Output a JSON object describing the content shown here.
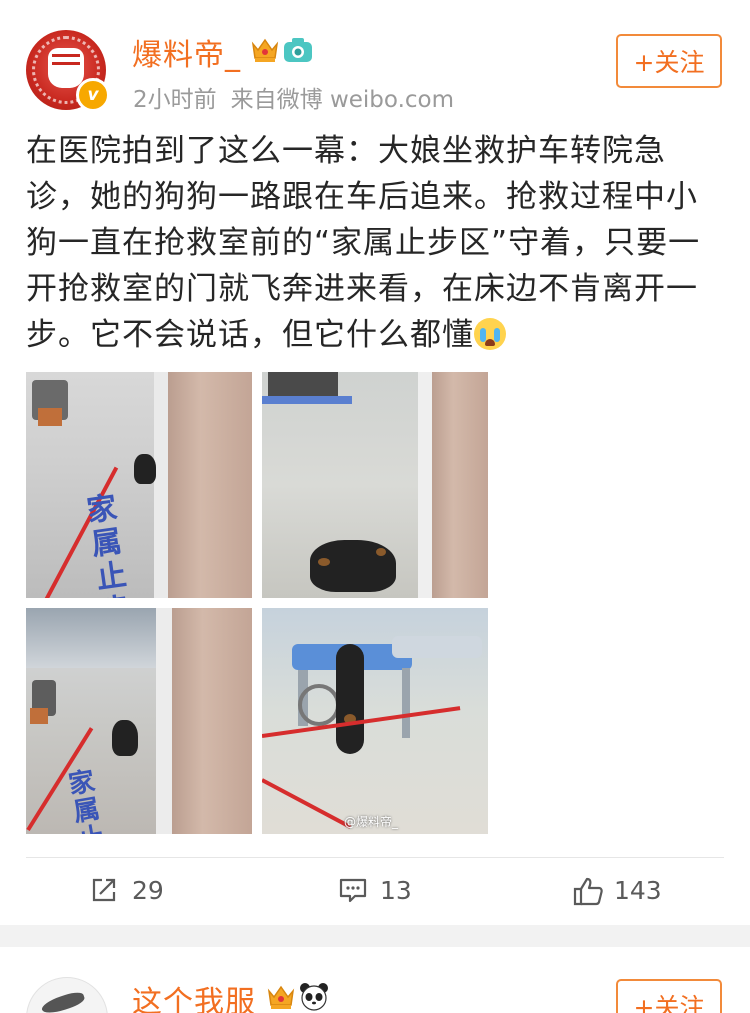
{
  "post": {
    "username": "爆料帝_",
    "time": "2小时前",
    "source": "来自微博 weibo.com",
    "follow_label": "+关注",
    "text": "在医院拍到了这么一幕：大娘坐救护车转院急诊，她的狗狗一路跟在车后追来。抢救过程中小狗一直在抢救室前的“家属止步区”守着，只要一开抢救室的门就飞奔进来看，在床边不肯离开一步。它不会说话，但它什么都懂",
    "photos": [
      {
        "floor_text": "家属止步"
      },
      {
        "floor_text": ""
      },
      {
        "floor_text": "家属止步"
      },
      {
        "watermark": "@爆料帝_"
      }
    ],
    "actions": {
      "repost_count": "29",
      "comment_count": "13",
      "like_count": "143"
    }
  },
  "next_post": {
    "username": "这个我服",
    "follow_label": "+关注"
  },
  "colors": {
    "accent": "#f26f21",
    "meta": "#9a9a9a"
  },
  "icons": [
    "verified-badge-icon",
    "crown-icon",
    "camera-icon",
    "crying-emoji-icon",
    "repost-icon",
    "comment-icon",
    "like-icon",
    "panda-icon"
  ]
}
